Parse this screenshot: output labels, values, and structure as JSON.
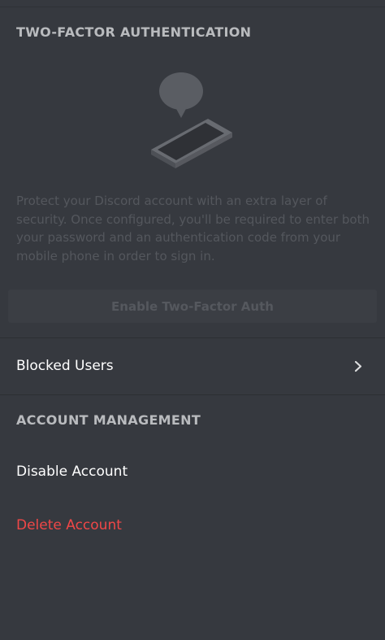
{
  "two_factor": {
    "section_title": "TWO-FACTOR AUTHENTICATION",
    "description": "Protect your Discord account with an extra layer of security. Once configured, you'll be required to enter both your password and an authentication code from your mobile phone in order to sign in.",
    "enable_button_label": "Enable Two-Factor Auth",
    "illustration_icon": "phone-with-speech-bubble-icon"
  },
  "blocked_users": {
    "label": "Blocked Users",
    "icon": "chevron-right-icon"
  },
  "account_management": {
    "section_title": "ACCOUNT MANAGEMENT",
    "disable_label": "Disable Account",
    "delete_label": "Delete Account"
  },
  "colors": {
    "background": "#36393f",
    "section_title": "#b9bbbe",
    "description_text": "#54575d",
    "disabled_button_bg": "#3b3e44",
    "disabled_button_text": "#55585e",
    "primary_text": "#ffffff",
    "danger_text": "#f04747"
  }
}
